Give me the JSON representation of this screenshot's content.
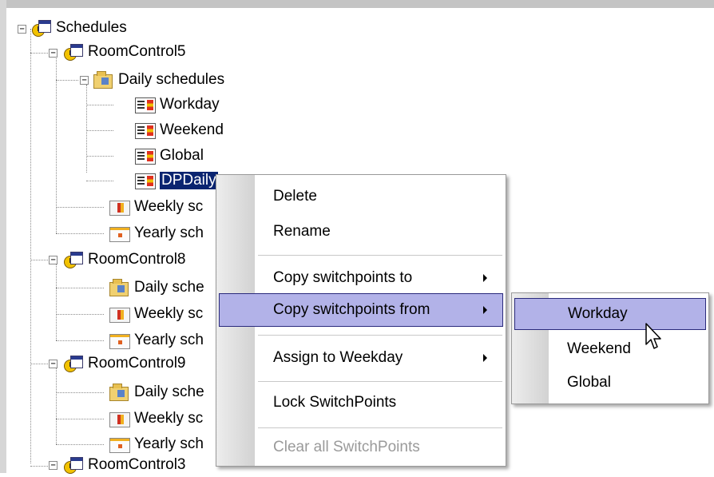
{
  "tree": {
    "root": {
      "label": "Schedules",
      "expander": "−"
    },
    "groups": [
      {
        "label": "RoomControl5",
        "expander": "−",
        "daily": {
          "label": "Daily schedules",
          "expander": "−",
          "items": [
            "Workday",
            "Weekend",
            "Global",
            "DPDaily"
          ]
        },
        "weekly": "Weekly sc",
        "yearly": "Yearly sch"
      },
      {
        "label": "RoomControl8",
        "expander": "−",
        "daily": {
          "label": "Daily sche"
        },
        "weekly": "Weekly sc",
        "yearly": "Yearly sch"
      },
      {
        "label": "RoomControl9",
        "expander": "−",
        "daily": {
          "label": "Daily sche"
        },
        "weekly": "Weekly sc",
        "yearly": "Yearly sch"
      },
      {
        "label": "RoomControl3",
        "expander": "−"
      }
    ]
  },
  "context_menu": {
    "items": [
      {
        "label": "Delete"
      },
      {
        "label": "Rename"
      },
      {
        "label": "Copy switchpoints to"
      },
      {
        "label": "Copy switchpoints from"
      },
      {
        "label": "Assign to Weekday"
      },
      {
        "label": "Lock SwitchPoints"
      },
      {
        "label": "Clear all SwitchPoints"
      }
    ]
  },
  "submenu": {
    "items": [
      {
        "label": "Workday"
      },
      {
        "label": "Weekend"
      },
      {
        "label": "Global"
      }
    ]
  },
  "colors": {
    "selection": "#0a2470",
    "menu_highlight": "#b2b2e8",
    "menu_highlight_border": "#2a2a7c",
    "disabled_text": "#9a9a9a"
  }
}
